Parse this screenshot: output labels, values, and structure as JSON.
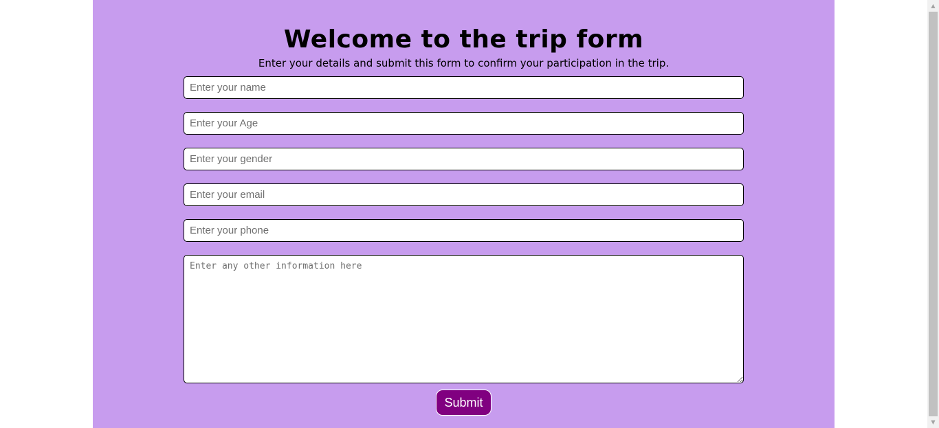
{
  "form": {
    "title": "Welcome to the trip form",
    "subtitle": "Enter your details and submit this form to confirm your participation in the trip.",
    "name_placeholder": "Enter your name",
    "age_placeholder": "Enter your Age",
    "gender_placeholder": "Enter your gender",
    "email_placeholder": "Enter your email",
    "phone_placeholder": "Enter your phone",
    "info_placeholder": "Enter any other information here",
    "submit_label": "Submit"
  },
  "colors": {
    "background": "#c79cee",
    "submit_button": "#800080",
    "page": "#ffffff"
  },
  "icons": {
    "scroll_up": "triangle-up-icon",
    "scroll_down": "triangle-down-icon"
  }
}
